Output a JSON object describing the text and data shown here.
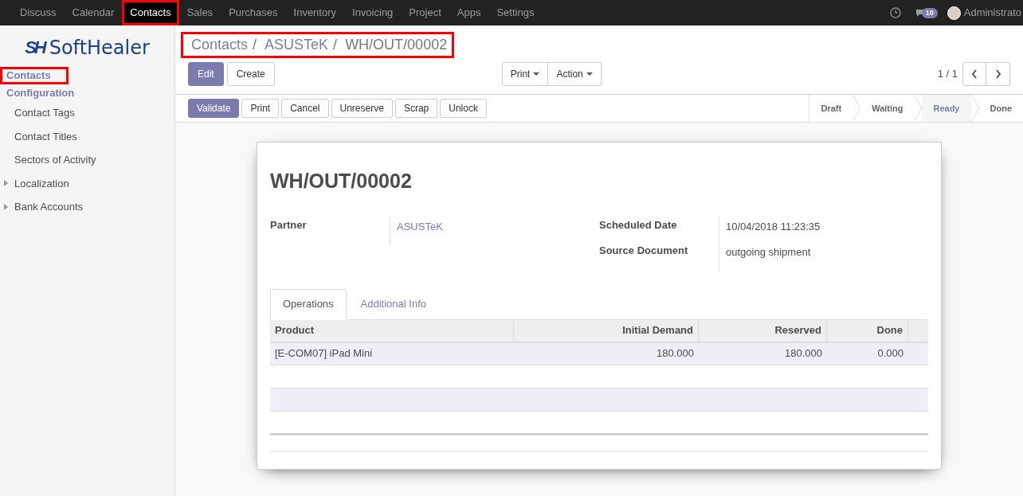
{
  "top_menu": [
    {
      "label": "Discuss",
      "selected": false,
      "highlighted": false
    },
    {
      "label": "Calendar",
      "selected": false,
      "highlighted": false
    },
    {
      "label": "Contacts",
      "selected": true,
      "highlighted": true
    },
    {
      "label": "Sales",
      "selected": false,
      "highlighted": false
    },
    {
      "label": "Purchases",
      "selected": false,
      "highlighted": false
    },
    {
      "label": "Inventory",
      "selected": false,
      "highlighted": false
    },
    {
      "label": "Invoicing",
      "selected": false,
      "highlighted": false
    },
    {
      "label": "Project",
      "selected": false,
      "highlighted": false
    },
    {
      "label": "Apps",
      "selected": false,
      "highlighted": false
    },
    {
      "label": "Settings",
      "selected": false,
      "highlighted": false
    }
  ],
  "systray": {
    "messages_badge": "10",
    "user": "Administrato"
  },
  "logo": {
    "mark": "SH",
    "name": "SoftHealer"
  },
  "sidebar": [
    {
      "label": "Contacts",
      "kind": "heading",
      "highlighted": true
    },
    {
      "label": "Configuration",
      "kind": "heading",
      "highlighted": false
    },
    {
      "label": "Contact Tags",
      "kind": "item",
      "highlighted": false
    },
    {
      "label": "Contact Titles",
      "kind": "item",
      "highlighted": false
    },
    {
      "label": "Sectors of Activity",
      "kind": "item",
      "highlighted": false
    },
    {
      "label": "Localization",
      "kind": "folder",
      "highlighted": false
    },
    {
      "label": "Bank Accounts",
      "kind": "folder",
      "highlighted": false
    }
  ],
  "breadcrumb": {
    "highlighted": true,
    "separator": "/",
    "items": [
      "Contacts",
      "ASUSTeK",
      "WH/OUT/00002"
    ]
  },
  "buttons": [
    {
      "label": "Edit",
      "primary": true
    },
    {
      "label": "Create",
      "primary": false
    }
  ],
  "dropdowns": [
    "Print",
    "Action"
  ],
  "pager": "1 / 1",
  "actions": [
    {
      "label": "Validate",
      "primary": true
    },
    {
      "label": "Print",
      "primary": false
    },
    {
      "label": "Cancel",
      "primary": false
    },
    {
      "label": "Unreserve",
      "primary": false
    },
    {
      "label": "Scrap",
      "primary": false
    },
    {
      "label": "Unlock",
      "primary": false
    }
  ],
  "stages": [
    {
      "label": "Draft",
      "selected": false
    },
    {
      "label": "Waiting",
      "selected": false
    },
    {
      "label": "Ready",
      "selected": true
    },
    {
      "label": "Done",
      "selected": false
    }
  ],
  "record": {
    "title": "WH/OUT/00002",
    "left_fields": [
      {
        "label": "Partner",
        "value": "ASUSTeK",
        "link": true
      }
    ],
    "right_fields": [
      {
        "label": "Scheduled Date",
        "value": "10/04/2018 11:23:35",
        "link": false
      },
      {
        "label": "Source Document",
        "value": "outgoing shipment",
        "link": false
      }
    ]
  },
  "tabs": [
    {
      "label": "Operations",
      "selected": true
    },
    {
      "label": "Additional Info",
      "selected": false
    }
  ],
  "table": {
    "columns": [
      "Product",
      "Initial Demand",
      "Reserved",
      "Done"
    ],
    "rows": [
      [
        "[E-COM07] iPad Mini",
        "180.000",
        "180.000",
        "0.000"
      ]
    ]
  }
}
